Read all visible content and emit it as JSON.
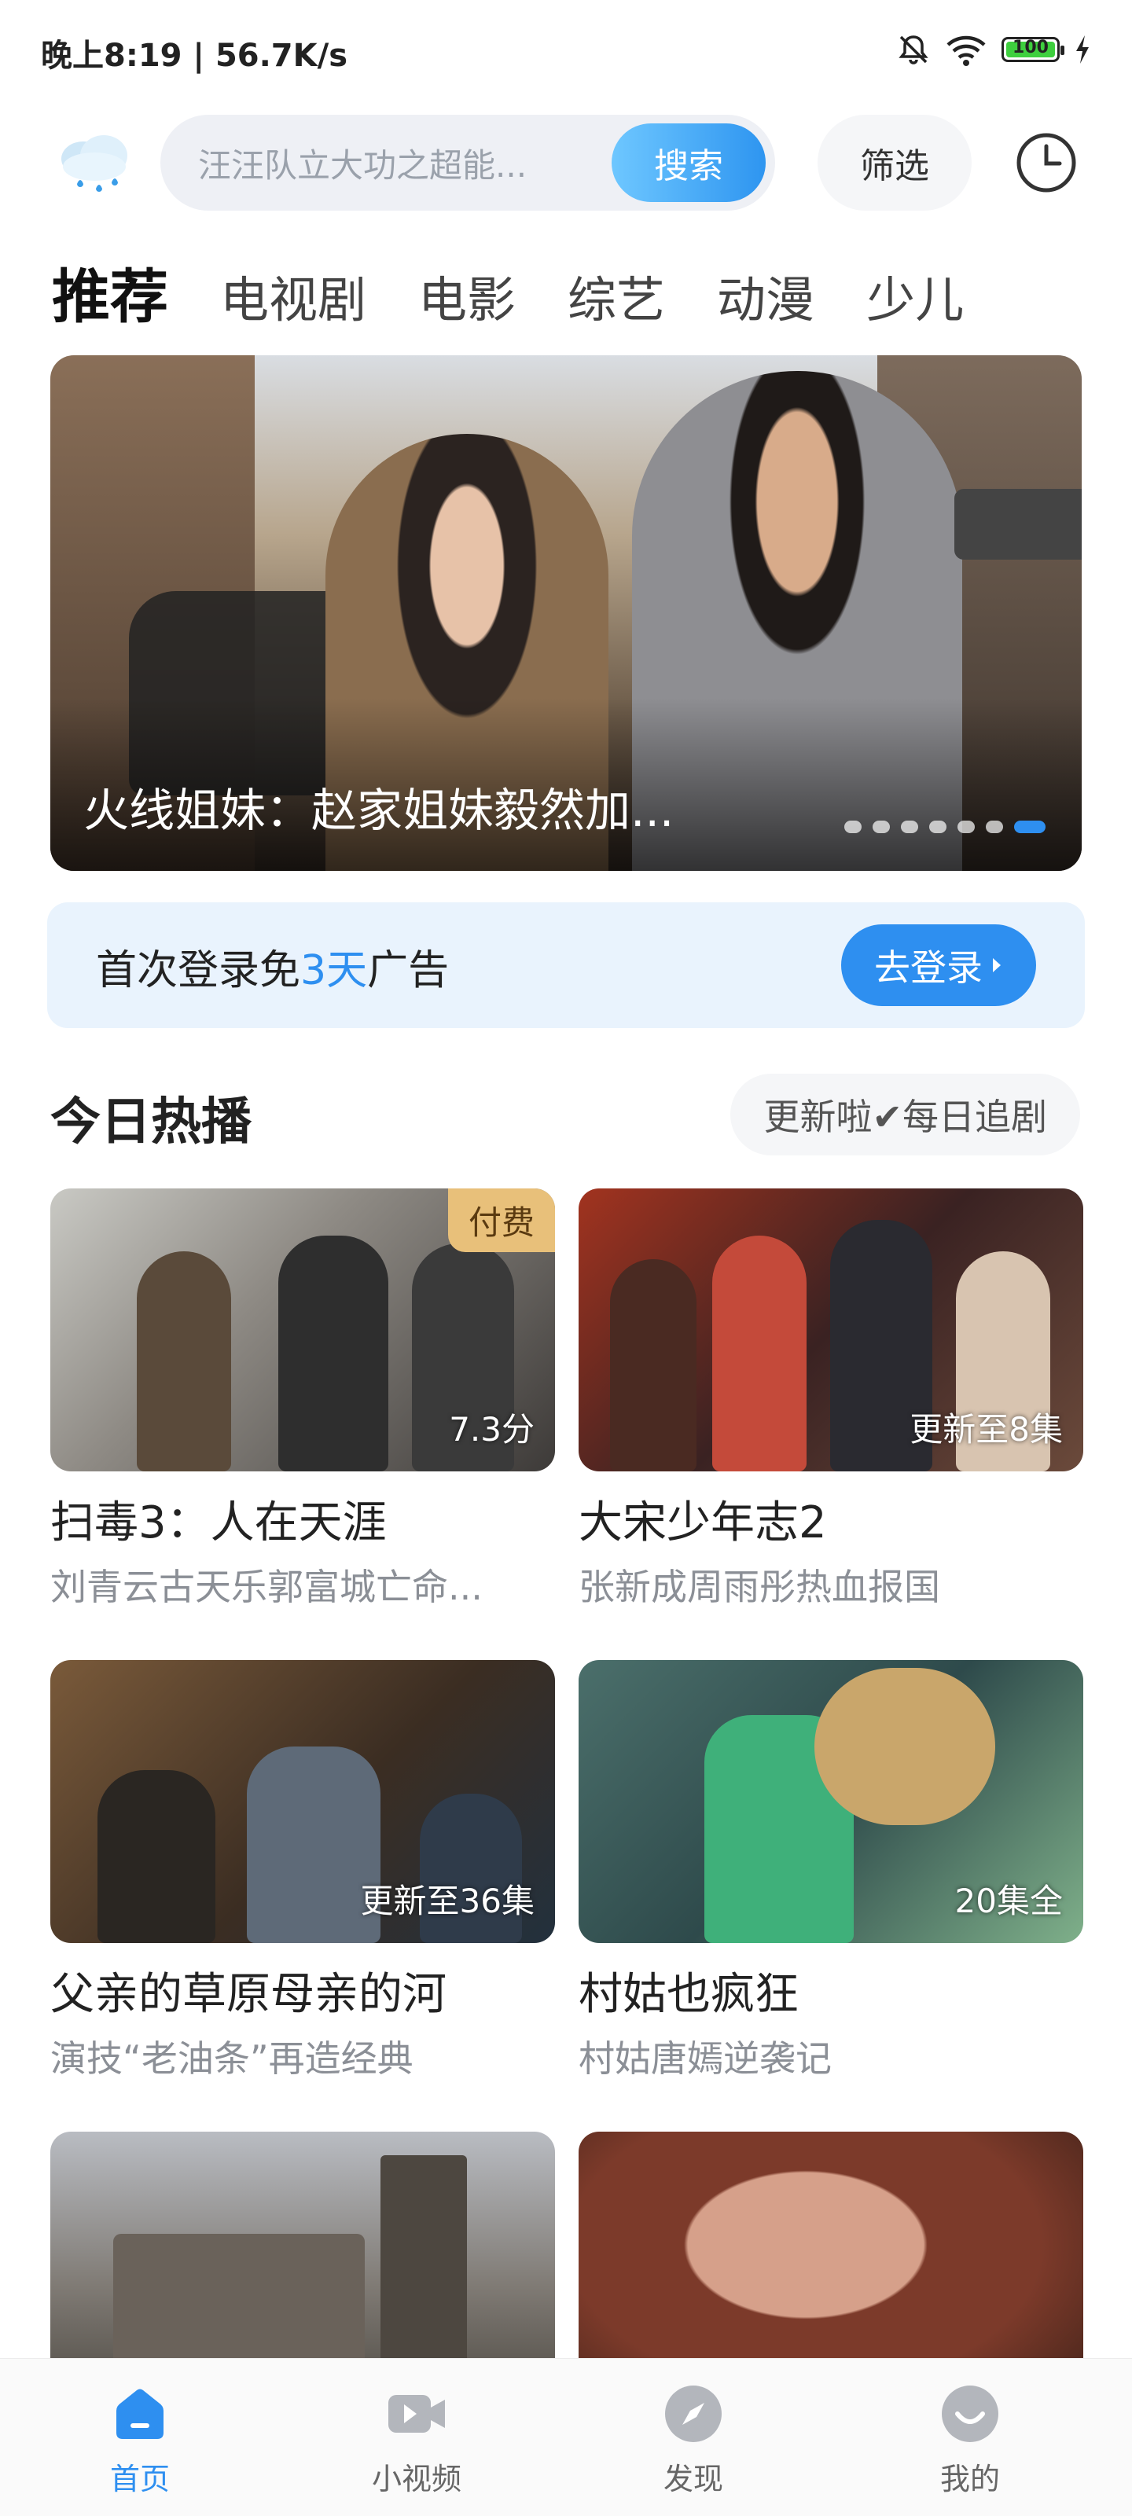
{
  "status_bar": {
    "time_speed": "晚上8:19 | 56.7K/s",
    "battery": "100"
  },
  "search": {
    "placeholder": "汪汪队立大功之超能...",
    "button_label": "搜索",
    "filter_label": "筛选"
  },
  "tabs": [
    "推荐",
    "电视剧",
    "电影",
    "综艺",
    "动漫",
    "少儿"
  ],
  "banner": {
    "title": "火线姐妹：赵家姐妹毅然加...",
    "slides": 7,
    "active_slide": 7
  },
  "login_promo": {
    "text_pre": "首次登录免",
    "text_highlight": "3天",
    "text_post": "广告",
    "button_label": "去登录"
  },
  "section": {
    "title": "今日热播",
    "pill_label": "更新啦✔每日追剧"
  },
  "cards": [
    {
      "title": "扫毒3：人在天涯",
      "subtitle": "刘青云古天乐郭富城亡命...",
      "badge": "7.3分",
      "pay_tag": "付费"
    },
    {
      "title": "大宋少年志2",
      "subtitle": "张新成周雨彤热血报国",
      "badge": "更新至8集",
      "pay_tag": ""
    },
    {
      "title": "父亲的草原母亲的河",
      "subtitle": "演技“老油条”再造经典",
      "badge": "更新至36集",
      "pay_tag": ""
    },
    {
      "title": "村姑也疯狂",
      "subtitle": "村姑唐嫣逆袭记",
      "badge": "20集全",
      "pay_tag": ""
    },
    {
      "title": "",
      "subtitle": "",
      "badge": "",
      "pay_tag": ""
    },
    {
      "title": "",
      "subtitle": "",
      "badge": "",
      "pay_tag": ""
    }
  ],
  "bottom_nav": [
    {
      "label": "首页",
      "icon": "home-icon",
      "active": true
    },
    {
      "label": "小视频",
      "icon": "video-icon",
      "active": false
    },
    {
      "label": "发现",
      "icon": "compass-icon",
      "active": false
    },
    {
      "label": "我的",
      "icon": "profile-icon",
      "active": false
    }
  ],
  "colors": {
    "accent": "#2e8ff0",
    "pay_badge": "#e8c07a"
  }
}
